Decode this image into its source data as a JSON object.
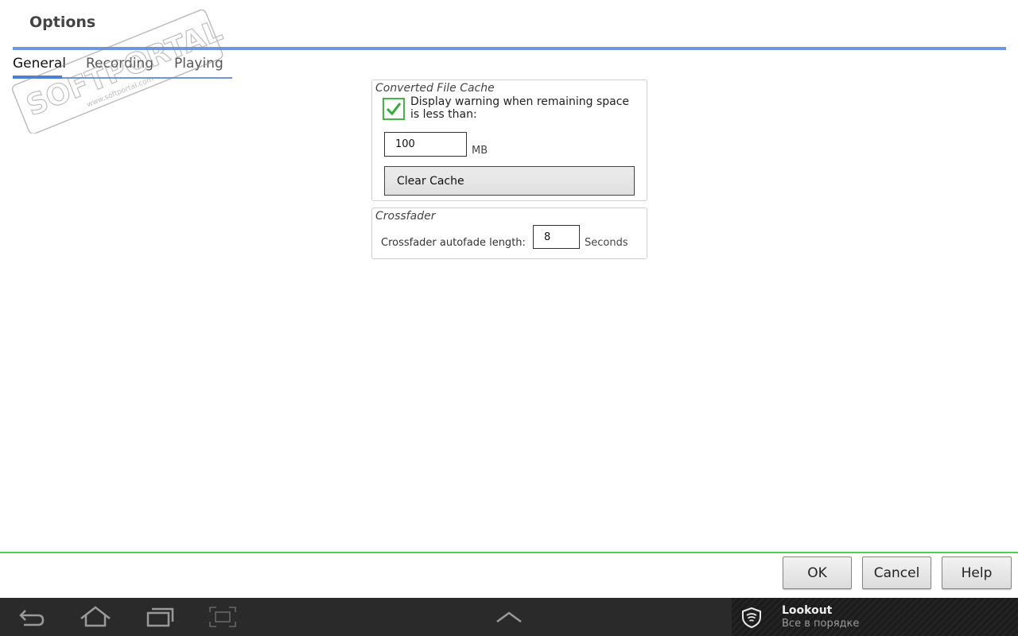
{
  "window": {
    "title": "Options"
  },
  "tabs": [
    {
      "label": "General",
      "active": true
    },
    {
      "label": "Recording",
      "active": false
    },
    {
      "label": "Playing",
      "active": false
    }
  ],
  "converted_file_cache": {
    "title": "Converted File Cache",
    "warning_checkbox": {
      "label": "Display warning when remaining space is less than:",
      "checked": true
    },
    "threshold": {
      "value": "100",
      "unit": "MB"
    },
    "clear_button": "Clear Cache"
  },
  "crossfader": {
    "title": "Crossfader",
    "autofade_label": "Crossfader autofade length:",
    "autofade": {
      "value": "8",
      "unit": "Seconds"
    }
  },
  "footer": {
    "ok": "OK",
    "cancel": "Cancel",
    "help": "Help"
  },
  "system_bar": {
    "nav_icons": [
      "back-icon",
      "home-icon",
      "recent-apps-icon",
      "screenshot-icon",
      "chevron-up-icon"
    ],
    "notification": {
      "icon": "lookout-shield-icon",
      "title": "Lookout",
      "subtitle": "Все в порядке"
    }
  },
  "watermark": {
    "brand": "SOFTPORTAL",
    "url": "www.softportal.com"
  },
  "colors": {
    "accent_blue": "#6f96e0",
    "check_green": "#3fb93f",
    "footer_green": "#4ed24e",
    "system_bar": "#2a2a2a"
  }
}
